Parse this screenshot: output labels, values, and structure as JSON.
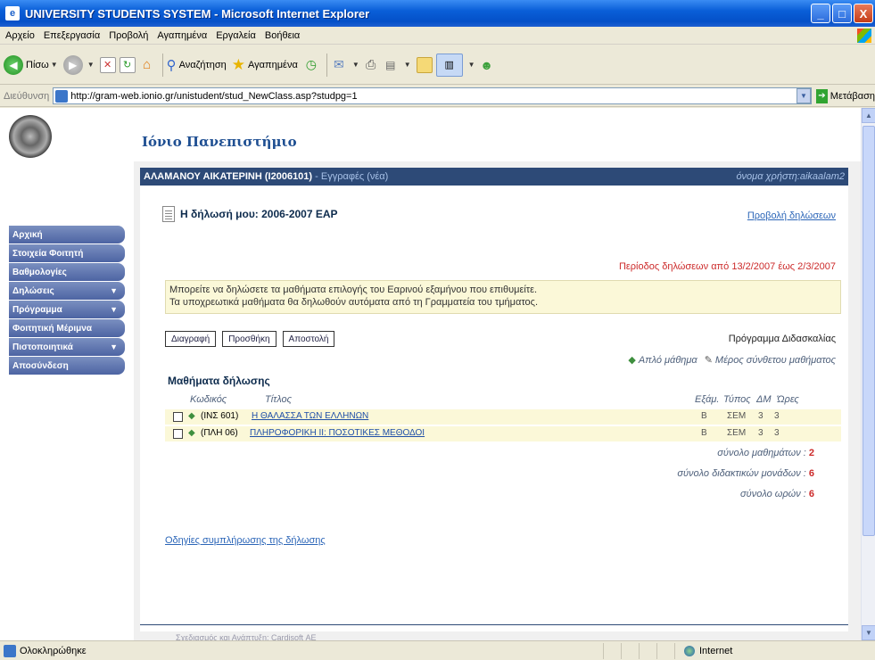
{
  "window": {
    "title": "UNIVERSITY STUDENTS SYSTEM - Microsoft Internet Explorer",
    "minimize": "_",
    "maximize": "□",
    "close": "X"
  },
  "menu": [
    "Αρχείο",
    "Επεξεργασία",
    "Προβολή",
    "Αγαπημένα",
    "Εργαλεία",
    "Βοήθεια"
  ],
  "toolbar": {
    "back": "Πίσω",
    "search": "Αναζήτηση",
    "favorites": "Αγαπημένα"
  },
  "address": {
    "label": "Διεύθυνση",
    "url": "http://gram-web.ionio.gr/unistudent/stud_NewClass.asp?studpg=1",
    "go": "Μετάβαση"
  },
  "page": {
    "university": "Ιόνιο Πανεπιστήμιο",
    "student": "ΑΛΑΜΑΝΟΥ ΑΙΚΑΤΕΡΙΝΗ (I2006101)",
    "section": "- Εγγραφές (νέα)",
    "username_label": "όνομα χρήστη:aikaalam2",
    "declaration_title": "Η δήλωσή μου: 2006-2007 ΕΑΡ",
    "view_declarations": "Προβολή δηλώσεων",
    "period": "Περίοδος δηλώσεων από 13/2/2007 έως 2/3/2007",
    "notice_line1": "Μπορείτε να δηλώσετε τα μαθήματα επιλογής του Εαρινού εξαμήνου που επιθυμείτε.",
    "notice_line2": "Τα υποχρεωτικά μαθήματα θα δηλωθούν αυτόματα από τη Γραμματεία του τμήματος.",
    "btn_delete": "Διαγραφή",
    "btn_add": "Προσθήκη",
    "btn_send": "Αποστολή",
    "schedule": "Πρόγραμμα Διδασκαλίας",
    "legend_simple": "Απλό μάθημα",
    "legend_part": "Μέρος σύνθετου μαθήματος",
    "courses_title": "Μαθήματα δήλωσης",
    "instructions": "Οδηγίες συμπλήρωσης της δήλωσης",
    "footer": "Σχεδιασμός και Ανάπτυξη: Cardisoft ΑΕ"
  },
  "sidebar": [
    {
      "label": "Αρχική",
      "has_arrow": false
    },
    {
      "label": "Στοιχεία Φοιτητή",
      "has_arrow": false
    },
    {
      "label": "Βαθμολογίες",
      "has_arrow": false
    },
    {
      "label": "Δηλώσεις",
      "has_arrow": true
    },
    {
      "label": "Πρόγραμμα",
      "has_arrow": true
    },
    {
      "label": "Φοιτητική Μέριμνα",
      "has_arrow": false
    },
    {
      "label": "Πιστοποιητικά",
      "has_arrow": true
    },
    {
      "label": "Αποσύνδεση",
      "has_arrow": false
    }
  ],
  "table": {
    "headers": {
      "code": "Κωδικός",
      "title": "Τίτλος",
      "semester": "Εξάμ.",
      "type": "Τύπος",
      "units": "ΔΜ",
      "hours": "Ώρες"
    },
    "rows": [
      {
        "code": "(ΙΝΣ 601)",
        "title": "Η ΘΑΛΑΣΣΑ ΤΩΝ ΕΛΛΗΝΩΝ",
        "semester": "Β",
        "type": "ΣΕΜ",
        "units": "3",
        "hours": "3"
      },
      {
        "code": "(ΠΛΗ 06)",
        "title": "ΠΛΗΡΟΦΟΡΙΚΗ ΙΙ: ΠΟΣΟΤΙΚΕΣ ΜΕΘΟΔΟΙ",
        "semester": "Β",
        "type": "ΣΕΜ",
        "units": "3",
        "hours": "3"
      }
    ]
  },
  "totals": {
    "courses_label": "σύνολο μαθημάτων :",
    "courses": "2",
    "units_label": "σύνολο διδακτικών μονάδων :",
    "units": "6",
    "hours_label": "σύνολο ωρών :",
    "hours": "6"
  },
  "status": {
    "text": "Ολοκληρώθηκε",
    "zone": "Internet"
  }
}
